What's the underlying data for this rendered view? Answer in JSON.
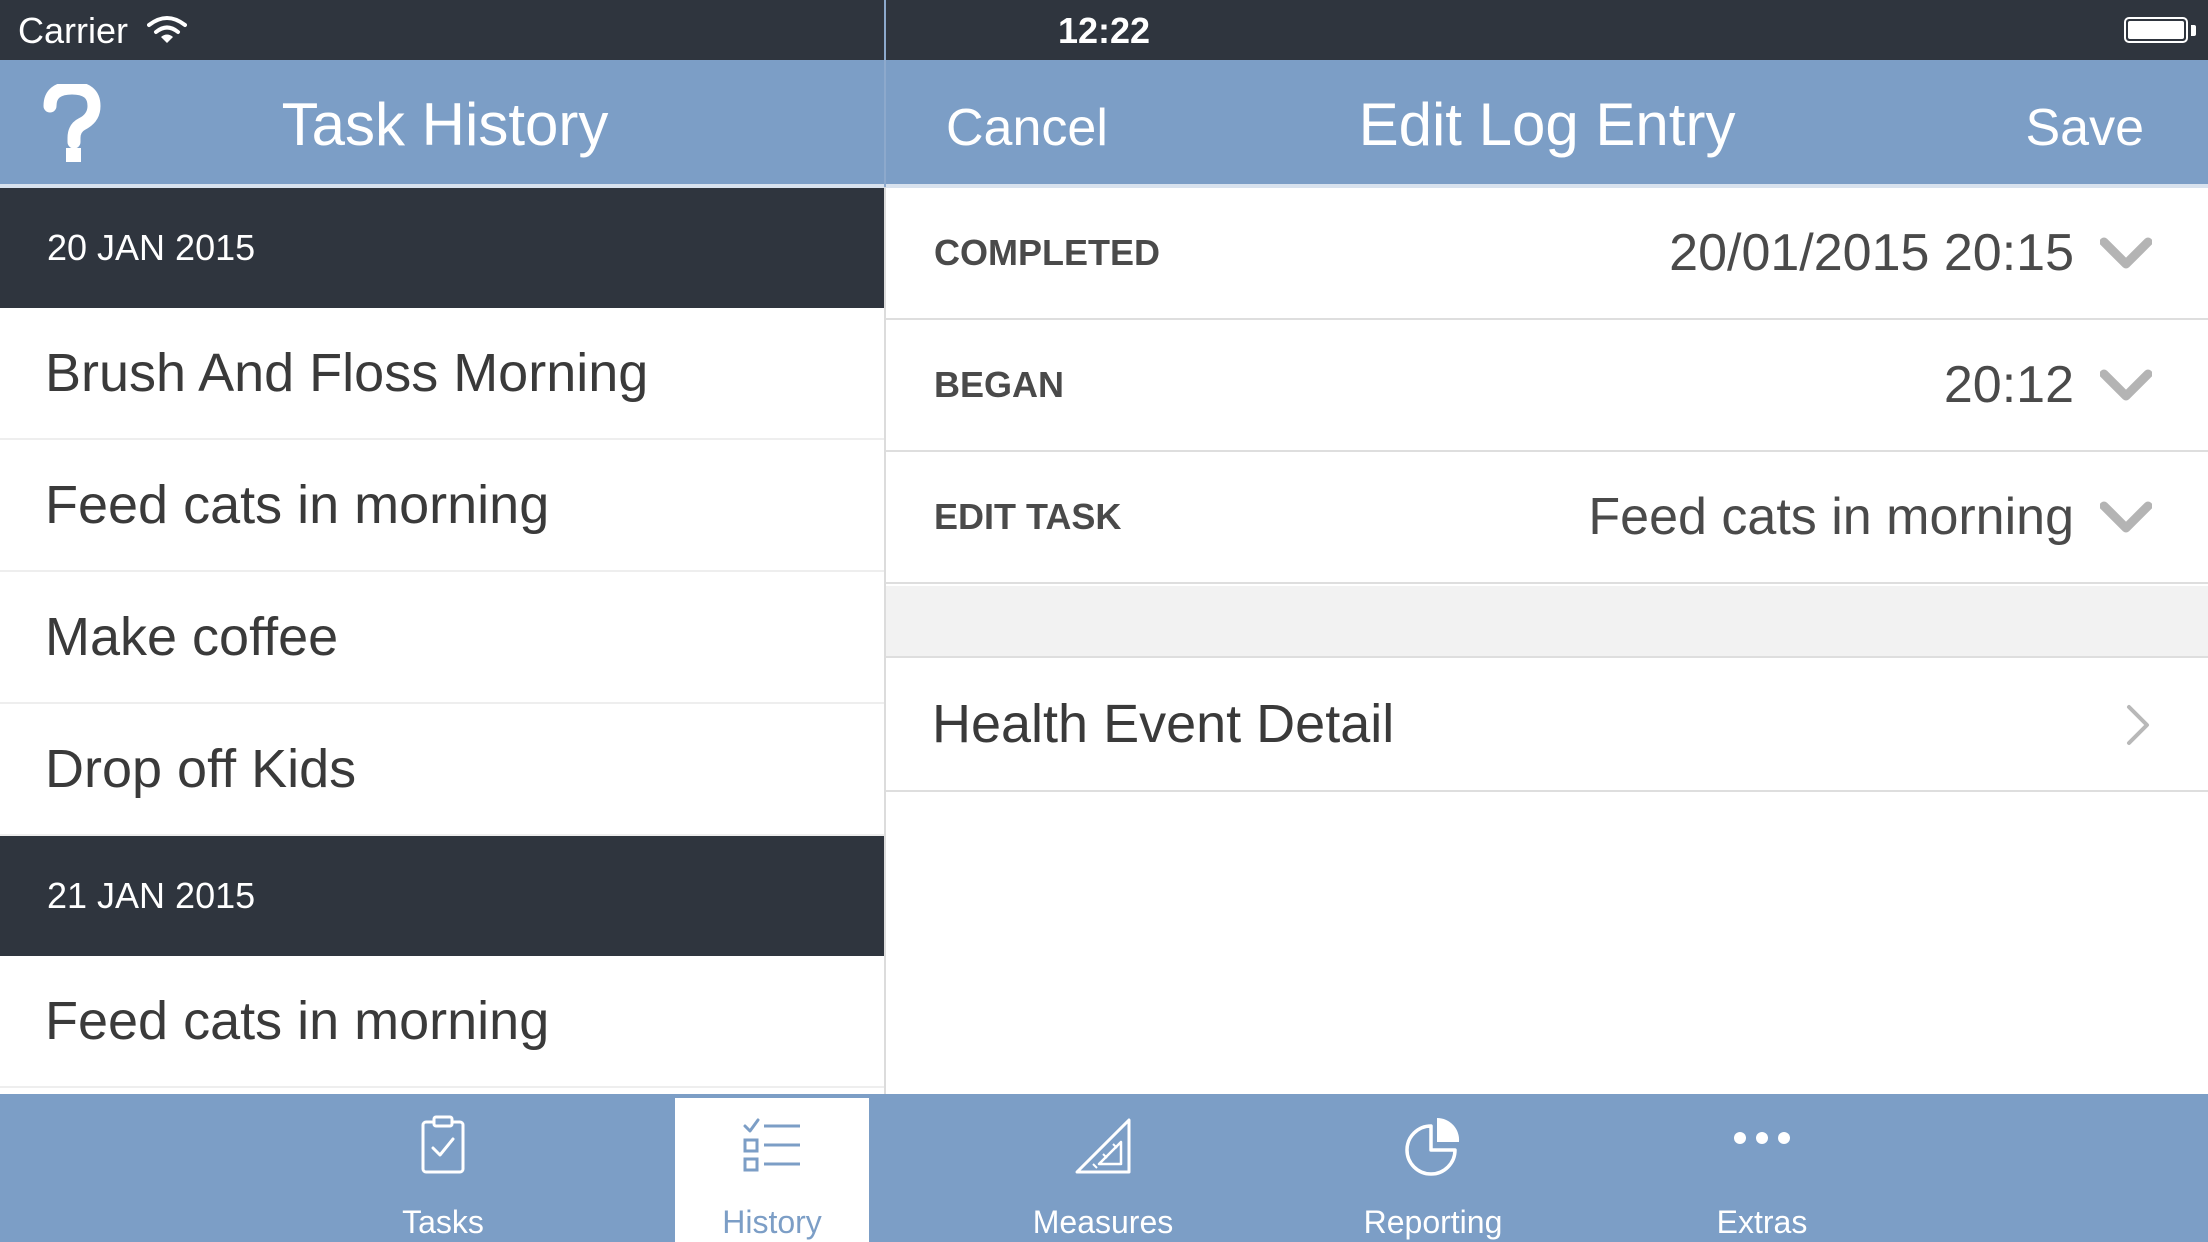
{
  "status_bar": {
    "carrier": "Carrier",
    "time": "12:22"
  },
  "left_nav": {
    "title": "Task History",
    "help_icon": "question-mark-icon"
  },
  "right_nav": {
    "cancel_label": "Cancel",
    "title": "Edit Log Entry",
    "save_label": "Save"
  },
  "history": {
    "sections": [
      {
        "date": "20 JAN 2015",
        "items": [
          "Brush And Floss Morning",
          "Feed cats in morning",
          "Make coffee",
          "Drop off Kids"
        ]
      },
      {
        "date": "21 JAN 2015",
        "items": [
          "Feed cats in morning"
        ]
      }
    ]
  },
  "edit_form": {
    "completed": {
      "label": "COMPLETED",
      "value": "20/01/2015 20:15"
    },
    "began": {
      "label": "BEGAN",
      "value": "20:12"
    },
    "task": {
      "label": "EDIT TASK",
      "value": "Feed cats in morning"
    },
    "health_link": "Health Event Detail"
  },
  "tab_bar": {
    "tabs": [
      {
        "label": "Tasks",
        "icon": "clipboard-check-icon"
      },
      {
        "label": "History",
        "icon": "checklist-icon",
        "active": true
      },
      {
        "label": "Measures",
        "icon": "set-square-icon"
      },
      {
        "label": "Reporting",
        "icon": "pie-chart-icon"
      },
      {
        "label": "Extras",
        "icon": "more-dots-icon"
      }
    ]
  },
  "colors": {
    "nav_bar": "#7c9ec6",
    "status_bar": "#2f353e",
    "section_header": "#2f353e",
    "text": "#3a3a3a"
  }
}
